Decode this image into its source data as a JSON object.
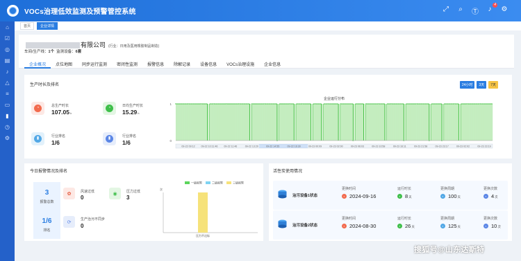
{
  "app": {
    "title": "VOCs治理低效监测及预警管控系统",
    "notification_count": "4"
  },
  "breadcrumbs": [
    {
      "label": "首页"
    },
    {
      "label": "企业详情"
    }
  ],
  "company": {
    "name_suffix": "有限公司",
    "industry": "(行业：日用及医用橡胶制品制造)",
    "stats_prefix": "车间/生产线：",
    "lines": "1个",
    "devices_label": "监测设备：",
    "devices": "6套"
  },
  "nav_tabs": [
    "企业概况",
    "点位地图",
    "同步运行监测",
    "密闭性监测",
    "报警信息",
    "除解记录",
    "设备信息",
    "VOCs治理设施",
    "企业信息"
  ],
  "production": {
    "title": "生产时长及排名",
    "range_buttons": [
      "24小时",
      "3天",
      "7天"
    ],
    "total_label": "总生产时长",
    "total_value": "107.05",
    "total_unit": "h",
    "daily_label": "日均生产时长",
    "daily_value": "15.29",
    "daily_unit": "h",
    "rank_label": "行业排名",
    "rank_value": "1/6",
    "rank2_label": "行业排名",
    "rank2_value": "1/6"
  },
  "chart_data": [
    {
      "type": "area",
      "title": "企业运行分布",
      "y_ticks": [
        "0",
        "1"
      ],
      "ylim": [
        0,
        1
      ],
      "x_tick_labels": [
        "09-22 09:12",
        "09-22 10:11:46",
        "09-22 11:46",
        "09-22 13:20",
        "09-22 14:55",
        "09-22 16:30",
        "09-23 00:09",
        "09-23 02:00",
        "09-23 06:03",
        "09-23 10:58",
        "09-23 16:11",
        "09-23 21:58",
        "09-23 23:17",
        "09-23 02:02",
        "09-23 23:19"
      ],
      "series": [
        {
          "color": "#3cbf3c",
          "values": [
            1,
            1,
            1,
            1,
            1,
            1,
            1,
            1,
            1,
            1,
            1,
            1,
            1,
            1,
            1,
            0,
            1,
            1,
            1,
            1,
            1,
            1,
            1,
            1,
            1,
            1,
            1,
            1,
            1,
            1,
            1,
            1,
            1,
            1,
            1,
            0,
            1,
            1,
            1,
            1,
            1,
            1,
            1,
            1,
            1,
            1,
            1,
            1,
            0,
            1,
            1,
            1,
            1,
            1,
            1,
            1,
            0,
            1,
            1,
            1,
            1,
            1,
            1,
            1,
            0,
            1,
            1,
            1,
            1,
            0,
            1,
            1,
            1,
            1,
            1,
            1,
            1,
            0,
            1,
            1,
            1,
            1,
            1,
            1,
            0,
            1,
            1,
            1,
            1,
            0,
            1,
            1,
            1,
            1,
            1,
            1,
            1,
            1,
            1,
            0,
            1,
            1,
            1,
            1,
            1,
            1,
            1,
            1,
            0,
            1,
            1,
            1,
            1,
            1,
            1,
            1,
            1,
            1,
            1,
            1,
            0,
            1,
            1,
            1,
            1,
            1,
            0,
            1,
            1,
            1,
            1,
            1,
            1,
            1,
            0,
            1,
            1,
            1,
            1,
            1,
            1,
            1,
            1,
            1,
            1,
            1,
            1,
            1,
            1,
            1
          ]
        }
      ]
    },
    {
      "type": "bar",
      "legend": [
        "一级报警",
        "二级报警",
        "三级报警"
      ],
      "colors": [
        "#5cd55c",
        "#7fd3f2",
        "#f6e27a"
      ],
      "categories": [
        "压力不达标"
      ],
      "y_label": "次",
      "ylim": [
        0,
        3
      ],
      "series": [
        {
          "name": "一级报警",
          "values": [
            0
          ]
        },
        {
          "name": "二级报警",
          "values": [
            0
          ]
        },
        {
          "name": "三级报警",
          "values": [
            3
          ]
        }
      ]
    }
  ],
  "alarms": {
    "title": "今日报警情况及排名",
    "total_value": "3",
    "total_label": "报警总数",
    "rank_value": "1/6",
    "rank_label": "排名",
    "wind_label": "风速过低",
    "wind_value": "0",
    "pressure_label": "压力过低",
    "pressure_value": "3",
    "sync_label": "生产治污不同步",
    "sync_value": "0"
  },
  "carbon": {
    "title": "活性炭使用情况",
    "devices": [
      {
        "name": "治污设备1状态",
        "replace_time_label": "更换时间",
        "replace_time": "2024-09-16",
        "run_label": "运行时长",
        "run_value": "8",
        "run_unit": "天",
        "cycle_label": "更换周期",
        "cycle_value": "100",
        "cycle_unit": "天",
        "count_label": "更换次数",
        "count_value": "4",
        "count_unit": "次"
      },
      {
        "name": "治污设备2状态",
        "replace_time_label": "更换时间",
        "replace_time": "2024-08-30",
        "run_label": "运行时长",
        "run_value": "26",
        "run_unit": "天",
        "cycle_label": "更换周期",
        "cycle_value": "125",
        "cycle_unit": "天",
        "count_label": "更换次数",
        "count_value": "10",
        "count_unit": "次"
      }
    ]
  },
  "watermark": "搜狐号@山东达斯特"
}
